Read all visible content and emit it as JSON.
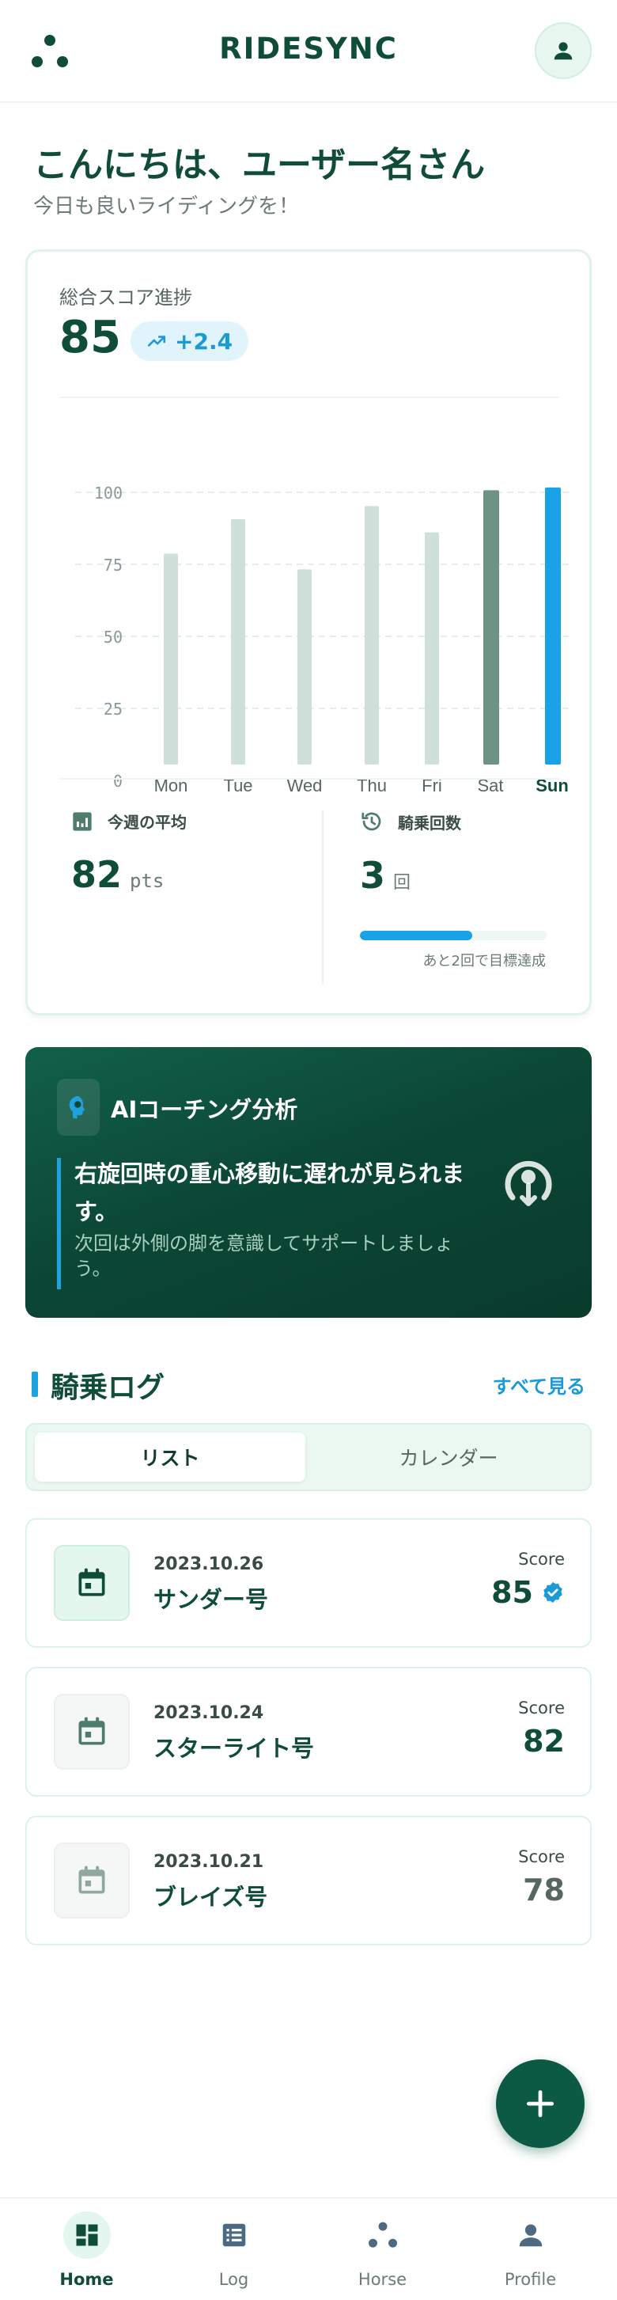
{
  "header": {
    "brand": "RIDESYNC",
    "logo_icon": "three-dots-logo",
    "profile_icon": "person-icon"
  },
  "greeting": {
    "title": "こんにちは、ユーザー名さん",
    "subtitle": "今日も良いライディングを！"
  },
  "score_card": {
    "title": "総合スコア進捗",
    "score": "85",
    "trend": "+2.4",
    "trend_icon": "trending-up-icon",
    "chart_data": {
      "type": "bar",
      "categories": [
        "Mon",
        "Tue",
        "Wed",
        "Thu",
        "Fri",
        "Sat",
        "Sun"
      ],
      "values": [
        80,
        93,
        74,
        98,
        88,
        104,
        105
      ],
      "ylim": [
        0,
        105
      ],
      "yticks": [
        "100",
        "75",
        "50",
        "25",
        "0"
      ],
      "grid": true,
      "highlight": "Sun",
      "colors": {
        "default": "#cfe0da",
        "sat": "#6e9385",
        "sun": "#19a3e6"
      }
    },
    "weekly_avg": {
      "label": "今週の平均",
      "value": "82",
      "unit": "pts",
      "icon": "bar-chart-icon"
    },
    "ride_count": {
      "label": "騎乗回数",
      "value": "3",
      "unit": "回",
      "icon": "history-icon",
      "progress": 0.6,
      "note": "あと2回で目標達成"
    }
  },
  "ai_card": {
    "title": "AIコーチング分析",
    "icon": "brain-icon",
    "main": "右旋回時の重心移動に遅れが見られます。",
    "sub": "次回は外側の脚を意識してサポートしましょう。",
    "deco_icon": "rotate-right-icon"
  },
  "log": {
    "title": "騎乗ログ",
    "see_all": "すべて見る",
    "tabs": [
      "リスト",
      "カレンダー"
    ],
    "score_label": "Score",
    "items": [
      {
        "date": "2023.10.26",
        "name": "サンダー号",
        "score": "85",
        "verified": true
      },
      {
        "date": "2023.10.24",
        "name": "スターライト号",
        "score": "82",
        "verified": false
      },
      {
        "date": "2023.10.21",
        "name": "ブレイズ号",
        "score": "78",
        "verified": false
      }
    ]
  },
  "fab": {
    "icon": "plus-icon"
  },
  "nav": [
    {
      "label": "Home",
      "icon": "dashboard-icon",
      "active": true
    },
    {
      "label": "Log",
      "icon": "list-icon",
      "active": false
    },
    {
      "label": "Horse",
      "icon": "three-dots-icon",
      "active": false
    },
    {
      "label": "Profile",
      "icon": "person-icon",
      "active": false
    }
  ],
  "colors": {
    "primary": "#0f4d39",
    "accent": "#19a3e6",
    "mint": "#eaf8f1"
  }
}
